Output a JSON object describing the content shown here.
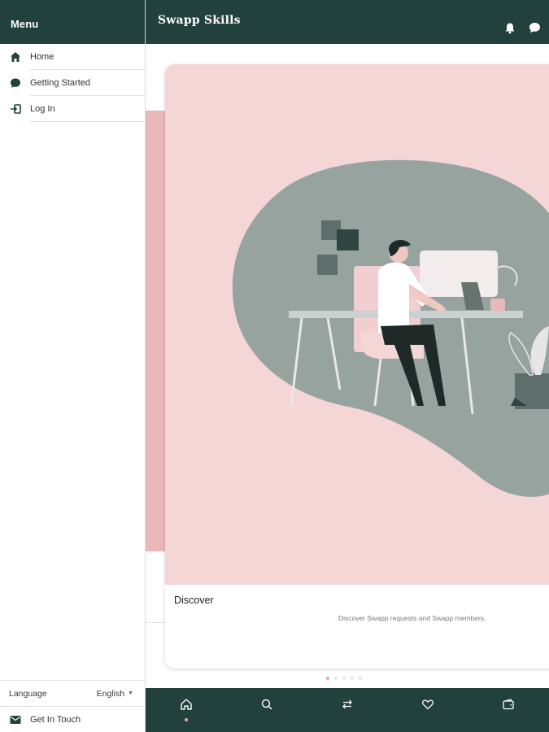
{
  "sidebar": {
    "title": "Menu",
    "items": [
      {
        "label": "Home",
        "icon": "home-icon"
      },
      {
        "label": "Getting Started",
        "icon": "chat-bubble-icon"
      },
      {
        "label": "Log In",
        "icon": "login-icon"
      }
    ],
    "language_label": "Language",
    "language_value": "English",
    "get_in_touch": "Get In Touch"
  },
  "header": {
    "title": "Swapp Skills",
    "icons": [
      "bell-icon",
      "chat-icon"
    ]
  },
  "carousel": {
    "active_index": 0,
    "total": 5,
    "card": {
      "title": "Discover",
      "description": "Discover Swapp requests and Swapp members."
    }
  },
  "bottom_nav": {
    "tabs": [
      "home-icon",
      "search-icon",
      "swap-icon",
      "heart-icon",
      "wallet-icon"
    ],
    "active": "home-icon"
  },
  "colors": {
    "brand_dark": "#22403c",
    "accent_pink": "#e8a7aa",
    "card_bg": "#f4d6d7",
    "blob": "#96a39f"
  }
}
